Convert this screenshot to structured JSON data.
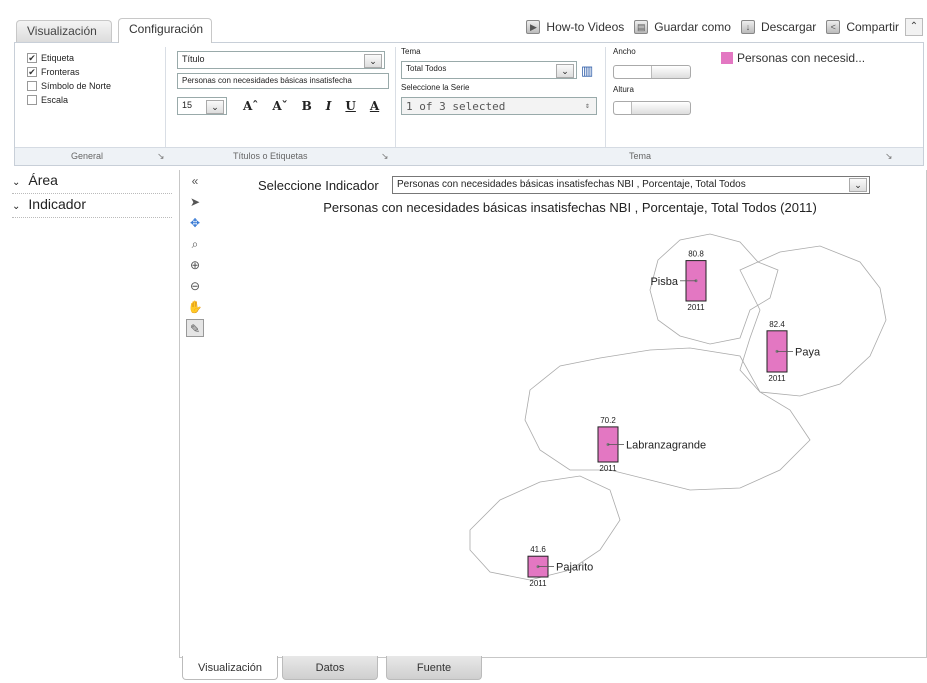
{
  "tabs": {
    "visualizacion": "Visualización",
    "configuracion": "Configuración"
  },
  "toolbar": {
    "howto": "How-to Videos",
    "guardar": "Guardar como",
    "descargar": "Descargar",
    "compartir": "Compartir",
    "collapse": "«"
  },
  "general": {
    "label": "General",
    "items": [
      {
        "label": "Etiqueta",
        "checked": true
      },
      {
        "label": "Fronteras",
        "checked": true
      },
      {
        "label": "Símbolo de Norte",
        "checked": false
      },
      {
        "label": "Escala",
        "checked": false
      }
    ]
  },
  "titulos": {
    "label": "Títulos o Etiquetas",
    "title_select": "Título",
    "title_text": "Personas con necesidades básicas insatisfecha",
    "font_size": "15"
  },
  "tema": {
    "label": "Tema",
    "tema_label": "Tema",
    "tema_value": "Total Todos",
    "serie_label": "Seleccione la Serie",
    "serie_value": "1 of 3 selected",
    "ancho_label": "Ancho",
    "altura_label": "Altura",
    "legend": "Personas con necesid..."
  },
  "left": {
    "area": "Área",
    "indicador": "Indicador"
  },
  "main": {
    "ind_label": "Seleccione Indicador",
    "ind_value": "Personas con necesidades básicas insatisfechas NBI , Porcentaje, Total Todos",
    "map_title": "Personas con necesidades básicas insatisfechas NBI , Porcentaje, Total Todos (2011)"
  },
  "chart_data": {
    "type": "bar",
    "title": "Personas con necesidades básicas insatisfechas NBI , Porcentaje, Total Todos (2011)",
    "categories": [
      "Pisba",
      "Paya",
      "Labranzagrande",
      "Pajarito"
    ],
    "year": "2011",
    "values": [
      80.8,
      82.4,
      70.2,
      41.6
    ],
    "color": "#e377c2"
  },
  "bottom_tabs": [
    "Visualización",
    "Datos",
    "Fuente"
  ]
}
